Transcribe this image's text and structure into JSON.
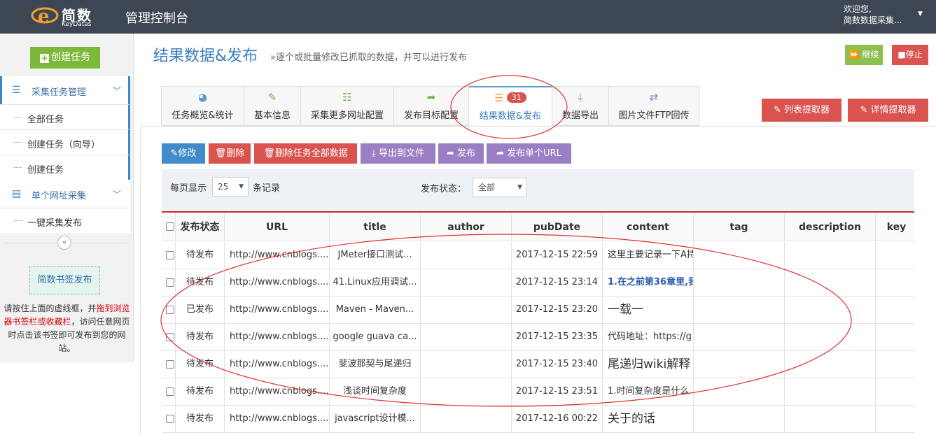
{
  "header": {
    "logo_name": "简数",
    "logo_sub": "KeyDatas",
    "app_title": "管理控制台",
    "welcome_line1": "欢迎您,",
    "welcome_line2": "简数数据采集..."
  },
  "sidebar": {
    "create_task": "创建任务",
    "groups": [
      {
        "label": "采集任务管理",
        "items": [
          "全部任务",
          "创建任务（向导）",
          "创建任务"
        ]
      },
      {
        "label": "单个网址采集",
        "items": [
          "一键采集发布"
        ]
      }
    ],
    "bookmark_button": "简数书签发布",
    "help_pre": "请按住上面的虚线框，并",
    "help_red": "拖到浏览器书签栏或收藏栏",
    "help_post": "，访问任意网页时点击该书签即可发布到您的网站。"
  },
  "page": {
    "title": "结果数据&发布",
    "subtitle": "»逐个或批量修改已抓取的数据，并可以进行发布",
    "continue_label": "继续",
    "stop_label": "停止"
  },
  "tabs": [
    {
      "label": "任务概览&统计",
      "icon": "dashboard-icon",
      "color": "#5b9bd5"
    },
    {
      "label": "基本信息",
      "icon": "edit-icon",
      "color": "#6bb049"
    },
    {
      "label": "采集更多网址配置",
      "icon": "list-icon",
      "color": "#6bb049"
    },
    {
      "label": "发布目标配置",
      "icon": "share-icon",
      "color": "#6bb049"
    },
    {
      "label": "结果数据&发布",
      "icon": "database-icon",
      "color": "#f0a030",
      "badge": "31"
    },
    {
      "label": "数据导出",
      "icon": "download-icon",
      "color": "#9b7fc4"
    },
    {
      "label": "图片文件FTP回传",
      "icon": "transfer-icon",
      "color": "#9b7fc4"
    }
  ],
  "extractors": {
    "list": "列表提取器",
    "detail": "详情提取器"
  },
  "actions": [
    "修改",
    "删除",
    "删除任务全部数据",
    "导出到文件",
    "发布",
    "发布单个URL"
  ],
  "filter": {
    "per_page_label": "每页显示",
    "per_page_value": "25",
    "records_label": "条记录",
    "status_label": "发布状态：",
    "status_value": "全部"
  },
  "table": {
    "columns": [
      "发布状态",
      "URL",
      "title",
      "author",
      "pubDate",
      "content",
      "tag",
      "description",
      "key"
    ],
    "rows": [
      {
        "status": "待发布",
        "url": "http://www.cnblogs....",
        "title": "JMeter接口测试...",
        "author": "",
        "date": "2017-12-15 22:59",
        "content": "这里主要记录一下A持"
      },
      {
        "status": "待发布",
        "url": "http://www.cnblogs....",
        "title": "41.Linux应用调试...",
        "author": "",
        "date": "2017-12-15 23:14",
        "content": "1.在之前第36章里,我"
      },
      {
        "status": "已发布",
        "url": "http://www.cnblogs....",
        "title": "Maven - Maven...",
        "author": "",
        "date": "2017-12-15 23:20",
        "content": "一载一"
      },
      {
        "status": "待发布",
        "url": "http://www.cnblogs....",
        "title": "google guava ca...",
        "author": "",
        "date": "2017-12-15 23:35",
        "content": "代码地址：https://g"
      },
      {
        "status": "待发布",
        "url": "http://www.cnblogs....",
        "title": "斐波那契与尾递归",
        "author": "",
        "date": "2017-12-15 23:40",
        "content": "尾递归wiki解释"
      },
      {
        "status": "待发布",
        "url": "http://www.cnblogs....",
        "title": "浅谈时间复杂度",
        "author": "",
        "date": "2017-12-15 23:51",
        "content": "1.时间复杂度是什么"
      },
      {
        "status": "待发布",
        "url": "http://www.cnblogs....",
        "title": "javascript设计模...",
        "author": "",
        "date": "2017-12-16 00:22",
        "content": "关于的话"
      }
    ]
  }
}
